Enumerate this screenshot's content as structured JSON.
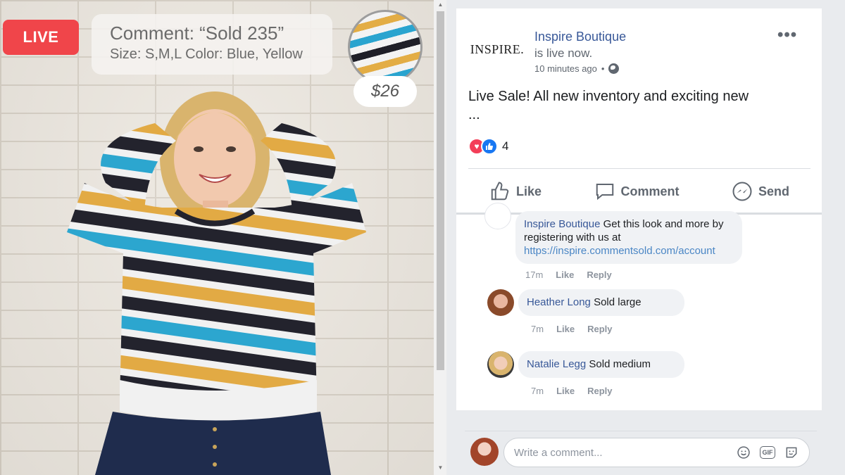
{
  "video": {
    "live_label": "LIVE",
    "comment_line1": "Comment: “Sold 235”",
    "comment_line2": "Size: S,M,L Color: Blue, Yellow",
    "price": "$26"
  },
  "post": {
    "logo_text": "INSPIRE.",
    "page_name": "Inspire Boutique",
    "status": "is live now.",
    "timestamp": "10 minutes ago",
    "text": "Live Sale! All new inventory and exciting new",
    "ellipsis": "...",
    "reaction_count": "4",
    "actions": {
      "like": "Like",
      "comment": "Comment",
      "send": "Send"
    }
  },
  "comments": [
    {
      "author": "Inspire Boutique",
      "text": " Get this look and more by registering with us at",
      "link": "https://inspire.commentsold.com/account",
      "time": "17m",
      "like": "Like",
      "reply": "Reply"
    },
    {
      "author": "Heather Long",
      "text": " Sold large",
      "time": "7m",
      "like": "Like",
      "reply": "Reply"
    },
    {
      "author": "Natalie Legg",
      "text": " Sold medium",
      "time": "7m",
      "like": "Like",
      "reply": "Reply"
    }
  ],
  "composer": {
    "placeholder": "Write a comment..."
  },
  "colors": {
    "live_red": "#f0454a",
    "fb_blue": "#385898",
    "link": "#4a86c5"
  }
}
